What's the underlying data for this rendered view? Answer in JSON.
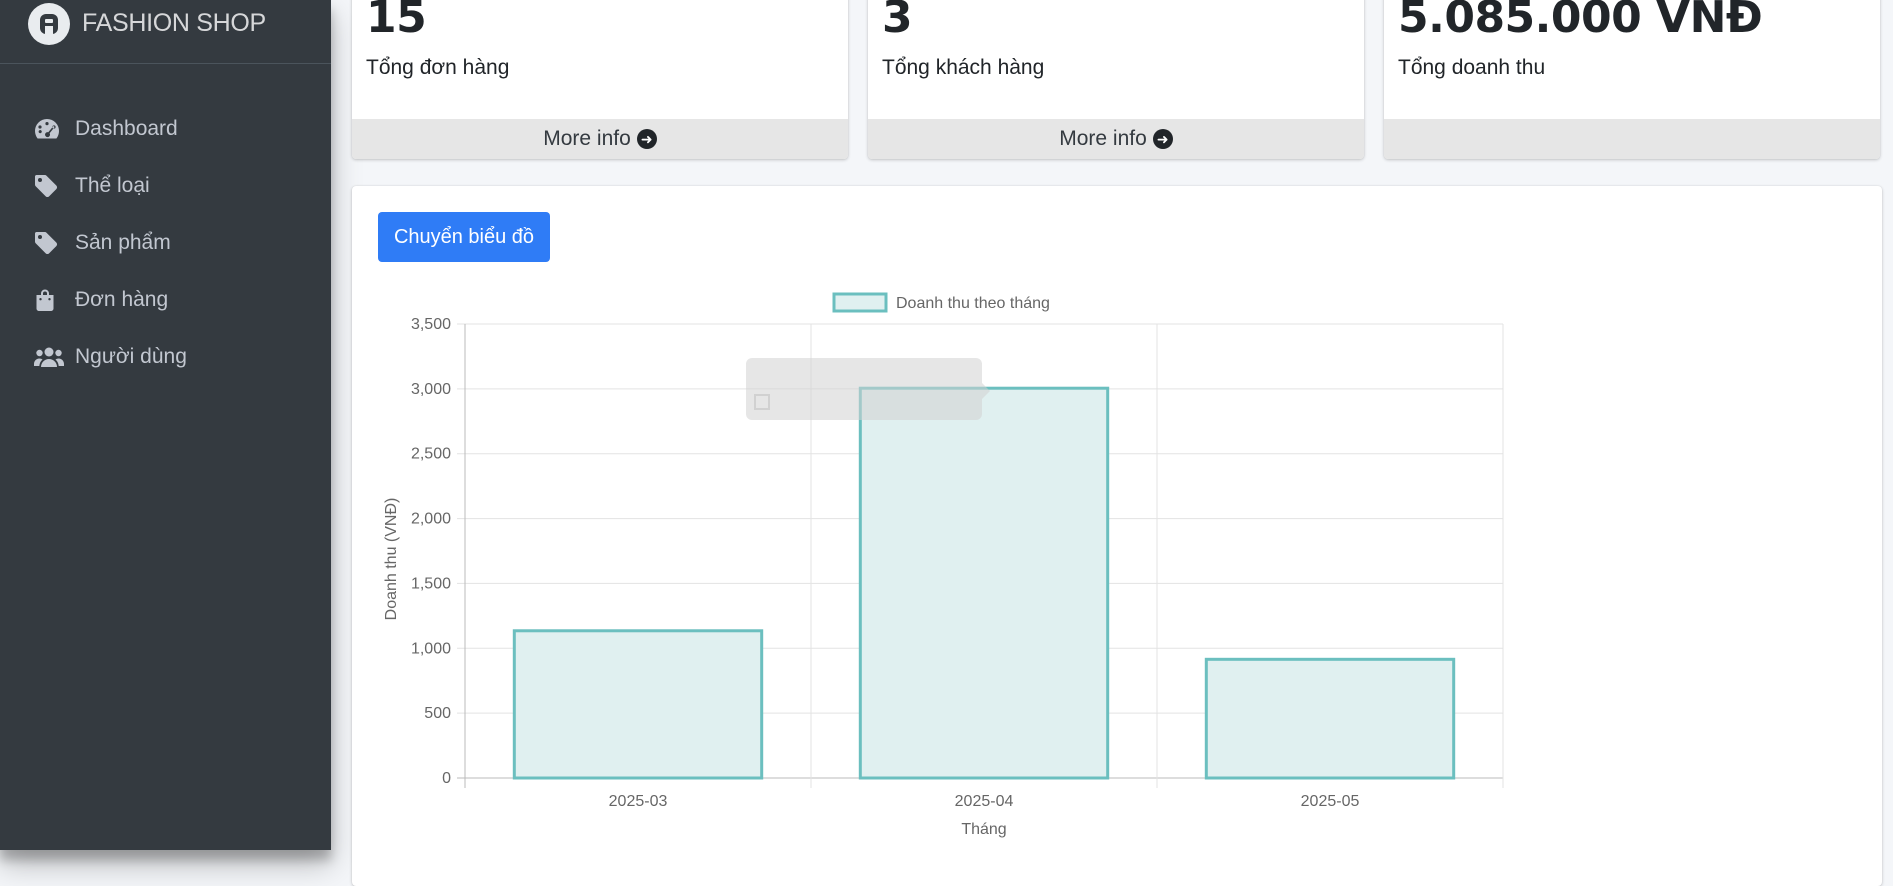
{
  "brand": {
    "name": "FASHION SHOP"
  },
  "sidebar": {
    "items": [
      {
        "label": "Dashboard",
        "icon": "tachometer-icon"
      },
      {
        "label": "Thể loại",
        "icon": "tag-icon"
      },
      {
        "label": "Sản phẩm",
        "icon": "tag-icon"
      },
      {
        "label": "Đơn hàng",
        "icon": "shopping-bag-icon"
      },
      {
        "label": "Người dùng",
        "icon": "users-icon"
      }
    ]
  },
  "stats": [
    {
      "value": "15",
      "label": "Tổng đơn hàng",
      "footer": "More info"
    },
    {
      "value": "3",
      "label": "Tổng khách hàng",
      "footer": "More info"
    },
    {
      "value": "5.085.000 VNĐ",
      "label": "Tổng doanh thu",
      "footer": ""
    }
  ],
  "chart_section": {
    "switch_button": "Chuyển biểu đồ"
  },
  "colors": {
    "bar_fill": "#e0f0f0",
    "bar_border": "#6bbfbf",
    "button": "#2f7cf6",
    "sidebar": "#343a40"
  },
  "chart_data": {
    "type": "bar",
    "categories": [
      "2025-03",
      "2025-04",
      "2025-05"
    ],
    "series": [
      {
        "name": "Doanh thu theo tháng",
        "values": [
          1135,
          3005,
          915
        ]
      }
    ],
    "xlabel": "Tháng",
    "ylabel": "Doanh thu (VNĐ)",
    "ylim": [
      0,
      3500
    ],
    "yticks": [
      "3,500",
      "3,000",
      "2,500",
      "2,000",
      "1,500",
      "1,000",
      "500",
      "0"
    ],
    "ytick_values": [
      3500,
      3000,
      2500,
      2000,
      1500,
      1000,
      500,
      0
    ],
    "grid": true,
    "legend": "top"
  }
}
